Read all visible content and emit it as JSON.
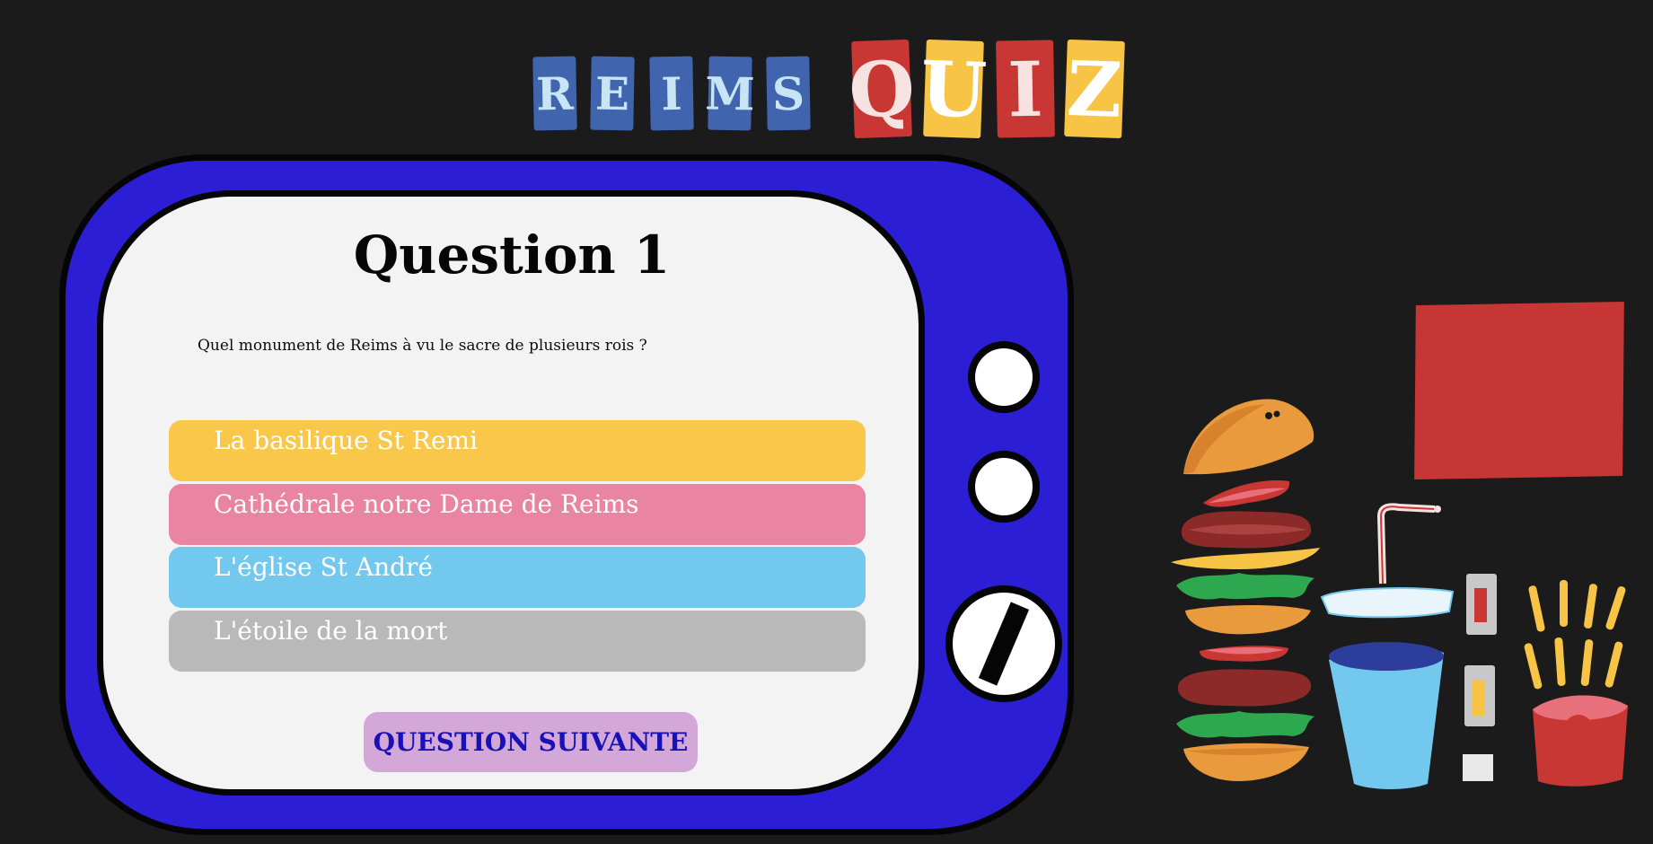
{
  "logo": {
    "word1": [
      "R",
      "E",
      "I",
      "M",
      "S"
    ],
    "word2": [
      "Q",
      "U",
      "I",
      "Z"
    ]
  },
  "quiz": {
    "title": "Question 1",
    "question": "Quel monument de Reims à vu le sacre de plusieurs rois ?",
    "answers": [
      "La basilique St Remi",
      "Cathédrale notre Dame de Reims",
      "L'église St André",
      "L'étoile de la mort"
    ],
    "next_label": "QUESTION SUIVANTE"
  },
  "colors": {
    "background": "#1c1b1c",
    "tv_frame": "#2c1ed4",
    "answer_1": "#f9c74a",
    "answer_2": "#ea84a3",
    "answer_3": "#73c8ee",
    "answer_4": "#b9b9b9",
    "next_button": "#d4a7d9"
  },
  "decorations": {
    "burger": "burger-illustration",
    "drink": "soda-cup-illustration",
    "fries": "fries-illustration",
    "sauces": "sauce-packets-illustration"
  }
}
